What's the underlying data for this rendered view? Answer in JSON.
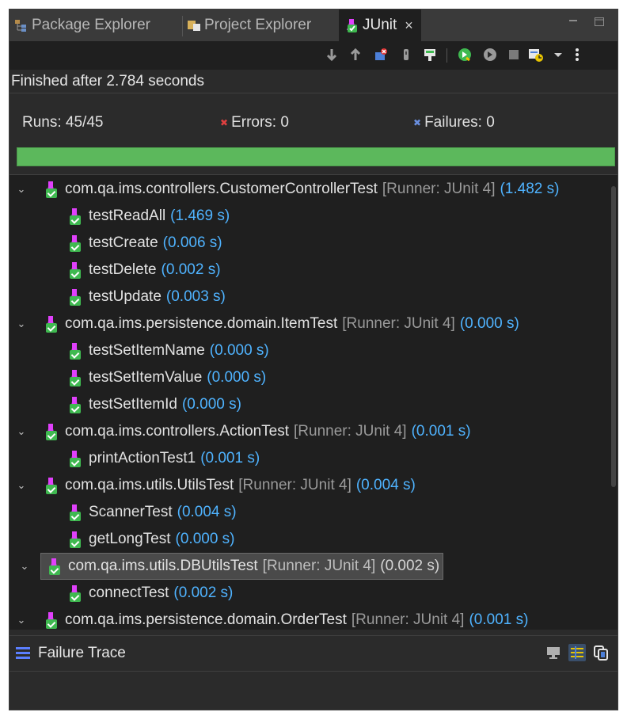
{
  "tabs": [
    {
      "label": "Package Explorer",
      "icon": "package-explorer-icon",
      "active": false
    },
    {
      "label": "Project Explorer",
      "icon": "project-explorer-icon",
      "active": false
    },
    {
      "label": "JUnit",
      "icon": "junit-icon",
      "active": true
    }
  ],
  "close_glyph": "×",
  "status": "Finished after 2.784 seconds",
  "counters": {
    "runs": "Runs:  45/45",
    "errors": "Errors:  0",
    "failures": "Failures:  0"
  },
  "progress": {
    "fraction": 1.0,
    "color": "#5cb85c"
  },
  "toolbar_icons": [
    "next-failure-icon",
    "previous-failure-icon",
    "show-failures-only-icon",
    "scroll-lock-icon",
    "layout-icon",
    "rerun-icon",
    "rerun-failed-icon",
    "stop-icon",
    "test-run-history-icon",
    "view-menu-icon",
    "more-icon"
  ],
  "tree": [
    {
      "type": "suite",
      "name": "com.qa.ims.controllers.CustomerControllerTest",
      "runner": "[Runner: JUnit 4]",
      "time": "(1.482 s)"
    },
    {
      "type": "test",
      "name": "testReadAll",
      "time": "(1.469 s)"
    },
    {
      "type": "test",
      "name": "testCreate",
      "time": "(0.006 s)"
    },
    {
      "type": "test",
      "name": "testDelete",
      "time": "(0.002 s)"
    },
    {
      "type": "test",
      "name": "testUpdate",
      "time": "(0.003 s)"
    },
    {
      "type": "suite",
      "name": "com.qa.ims.persistence.domain.ItemTest",
      "runner": "[Runner: JUnit 4]",
      "time": "(0.000 s)"
    },
    {
      "type": "test",
      "name": "testSetItemName",
      "time": "(0.000 s)"
    },
    {
      "type": "test",
      "name": "testSetItemValue",
      "time": "(0.000 s)"
    },
    {
      "type": "test",
      "name": "testSetItemId",
      "time": "(0.000 s)"
    },
    {
      "type": "suite",
      "name": "com.qa.ims.controllers.ActionTest",
      "runner": "[Runner: JUnit 4]",
      "time": "(0.001 s)"
    },
    {
      "type": "test",
      "name": "printActionTest1",
      "time": "(0.001 s)"
    },
    {
      "type": "suite",
      "name": "com.qa.ims.utils.UtilsTest",
      "runner": "[Runner: JUnit 4]",
      "time": "(0.004 s)"
    },
    {
      "type": "test",
      "name": "ScannerTest",
      "time": "(0.004 s)"
    },
    {
      "type": "test",
      "name": "getLongTest",
      "time": "(0.000 s)"
    },
    {
      "type": "suite",
      "name": "com.qa.ims.utils.DBUtilsTest",
      "runner": "[Runner: JUnit 4]",
      "time": "(0.002 s)",
      "selected": true
    },
    {
      "type": "test",
      "name": "connectTest",
      "time": "(0.002 s)"
    },
    {
      "type": "suite",
      "name": "com.qa.ims.persistence.domain.OrderTest",
      "runner": "[Runner: JUnit 4]",
      "time": "(0.001 s)"
    }
  ],
  "failure_trace": {
    "label": "Failure Trace"
  }
}
